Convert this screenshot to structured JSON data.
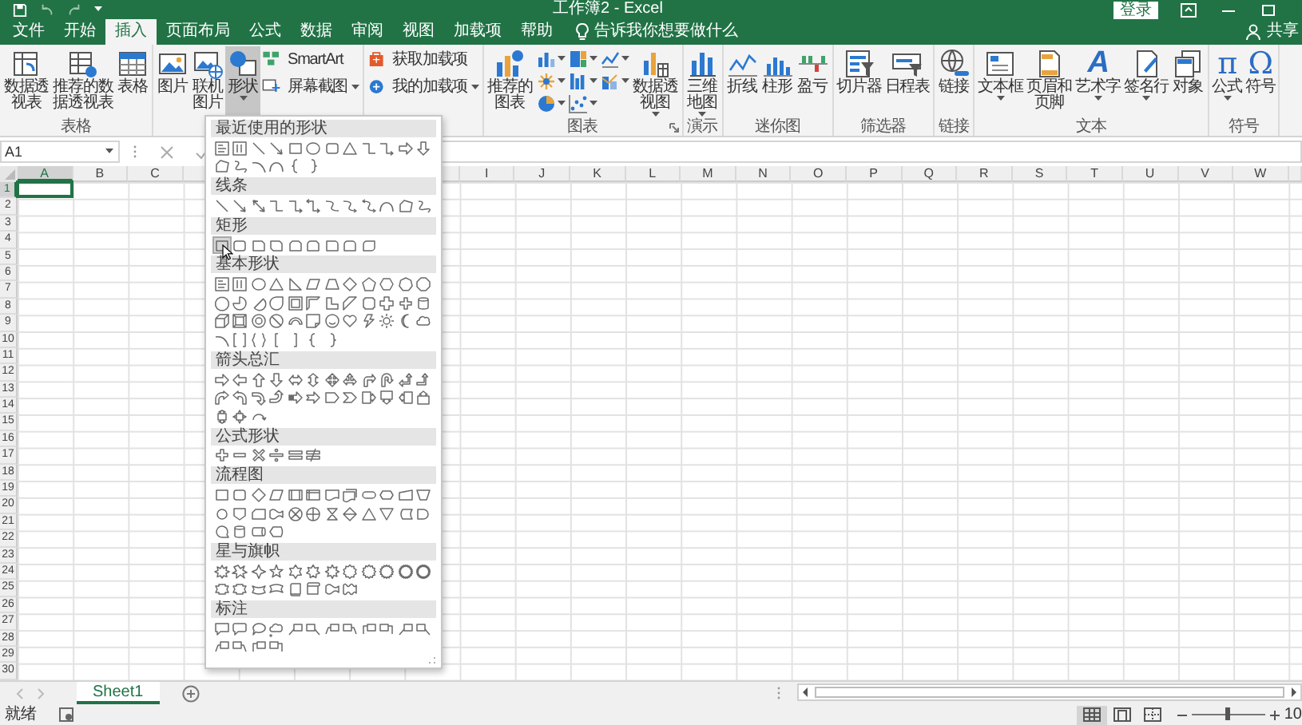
{
  "window": {
    "title": "工作簿2 - Excel",
    "login": "登录"
  },
  "tabs": [
    {
      "label": "文件",
      "selected": false
    },
    {
      "label": "开始",
      "selected": false
    },
    {
      "label": "插入",
      "selected": true
    },
    {
      "label": "页面布局",
      "selected": false
    },
    {
      "label": "公式",
      "selected": false
    },
    {
      "label": "数据",
      "selected": false
    },
    {
      "label": "审阅",
      "selected": false
    },
    {
      "label": "视图",
      "selected": false
    },
    {
      "label": "加载项",
      "selected": false
    },
    {
      "label": "帮助",
      "selected": false
    }
  ],
  "tell_me": "告诉我你想要做什么",
  "share": "共享",
  "ribbon_groups": [
    {
      "label": "表格",
      "items": [
        {
          "kind": "pivot",
          "label": "数据透视表"
        },
        {
          "kind": "recpivot",
          "label": "推荐的数据透视表"
        },
        {
          "kind": "table",
          "label": "表格"
        }
      ]
    },
    {
      "items": [
        {
          "kind": "picture",
          "label": "图片"
        },
        {
          "kind": "online",
          "label": "联机图片"
        },
        {
          "kind": "shapes",
          "label": "形状",
          "has_menu": true,
          "expanded": true
        },
        {
          "stack": [
            {
              "kind": "smartart",
              "label": "SmartArt"
            },
            {
              "kind": "screenshot",
              "label": "屏幕截图",
              "has_menu": true
            }
          ]
        }
      ]
    },
    {
      "items": [
        {
          "stack": [
            {
              "kind": "store",
              "label": "获取加载项"
            },
            {
              "kind": "myaddin",
              "label": "我的加载项",
              "has_menu": true
            }
          ]
        }
      ]
    },
    {
      "label": "图表",
      "launcher": true,
      "items": [
        {
          "kind": "recchart",
          "label": "推荐的图表"
        },
        {
          "chart_types": [
            {
              "kind": "col",
              "has_menu": true
            },
            {
              "kind": "hier",
              "has_menu": true
            },
            {
              "kind": "wfall",
              "has_menu": true
            },
            {
              "kind": "stat",
              "has_menu": true
            },
            {
              "kind": "bar",
              "has_menu": true
            },
            {
              "kind": "combo",
              "has_menu": true
            },
            {
              "kind": "pie",
              "has_menu": true
            },
            {
              "kind": "scatter",
              "has_menu": true
            }
          ]
        },
        {
          "kind": "pivotchart",
          "label": "数据透视图",
          "has_menu": true
        }
      ]
    },
    {
      "label": "演示",
      "items": [
        {
          "kind": "map",
          "label": "三维地图",
          "has_menu": true
        }
      ]
    },
    {
      "label": "迷你图",
      "items": [
        {
          "kind": "sline",
          "label": "折线"
        },
        {
          "kind": "scol",
          "label": "柱形"
        },
        {
          "kind": "swin",
          "label": "盈亏"
        }
      ]
    },
    {
      "label": "筛选器",
      "items": [
        {
          "kind": "slicer",
          "label": "切片器"
        },
        {
          "kind": "timeline",
          "label": "日程表"
        }
      ]
    },
    {
      "label": "链接",
      "items": [
        {
          "kind": "link",
          "label": "链接"
        }
      ]
    },
    {
      "label": "文本",
      "items": [
        {
          "kind": "textbox",
          "label": "文本框",
          "has_menu": true
        },
        {
          "kind": "header",
          "label": "页眉和页脚"
        },
        {
          "kind": "wordart",
          "glyph": "A",
          "label": "艺术字",
          "has_menu": true
        },
        {
          "kind": "sig",
          "label": "签名行",
          "has_menu": true
        },
        {
          "kind": "object",
          "label": "对象"
        }
      ]
    },
    {
      "label": "符号",
      "items": [
        {
          "kind": "equation",
          "glyph": "π",
          "label": "公式",
          "has_menu": true
        },
        {
          "kind": "symbol",
          "glyph": "Ω",
          "label": "符号"
        }
      ]
    }
  ],
  "name_box": "A1",
  "columns_left": [
    {
      "label": "A",
      "selected": true
    },
    {
      "label": "B",
      "selected": false
    },
    {
      "label": "C",
      "selected": false
    }
  ],
  "columns_right": [
    {
      "label": "I",
      "selected": false
    },
    {
      "label": "J",
      "selected": false
    },
    {
      "label": "K",
      "selected": false
    },
    {
      "label": "L",
      "selected": false
    },
    {
      "label": "M",
      "selected": false
    },
    {
      "label": "N",
      "selected": false
    },
    {
      "label": "O",
      "selected": false
    },
    {
      "label": "P",
      "selected": false
    },
    {
      "label": "Q",
      "selected": false
    },
    {
      "label": "R",
      "selected": false
    },
    {
      "label": "S",
      "selected": false
    },
    {
      "label": "T",
      "selected": false
    },
    {
      "label": "U",
      "selected": false
    },
    {
      "label": "V",
      "selected": false
    },
    {
      "label": "W",
      "selected": false
    }
  ],
  "rows": [
    {
      "label": "1",
      "selected": true
    },
    {
      "label": "2",
      "selected": false
    },
    {
      "label": "3",
      "selected": false
    },
    {
      "label": "4",
      "selected": false
    },
    {
      "label": "5",
      "selected": false
    },
    {
      "label": "6",
      "selected": false
    },
    {
      "label": "7",
      "selected": false
    },
    {
      "label": "8",
      "selected": false
    },
    {
      "label": "9",
      "selected": false
    },
    {
      "label": "10",
      "selected": false
    },
    {
      "label": "11",
      "selected": false
    },
    {
      "label": "12",
      "selected": false
    },
    {
      "label": "13",
      "selected": false
    },
    {
      "label": "14",
      "selected": false
    },
    {
      "label": "15",
      "selected": false
    },
    {
      "label": "16",
      "selected": false
    },
    {
      "label": "17",
      "selected": false
    },
    {
      "label": "18",
      "selected": false
    },
    {
      "label": "19",
      "selected": false
    },
    {
      "label": "20",
      "selected": false
    },
    {
      "label": "21",
      "selected": false
    },
    {
      "label": "22",
      "selected": false
    },
    {
      "label": "23",
      "selected": false
    },
    {
      "label": "24",
      "selected": false
    },
    {
      "label": "25",
      "selected": false
    },
    {
      "label": "26",
      "selected": false
    },
    {
      "label": "27",
      "selected": false
    },
    {
      "label": "28",
      "selected": false
    },
    {
      "label": "29",
      "selected": false
    },
    {
      "label": "30",
      "selected": false
    }
  ],
  "shape_menu": {
    "sections": [
      {
        "title": "最近使用的形状",
        "shapes": [
          {
            "kind": "tb"
          },
          {
            "kind": "tbv"
          },
          {
            "kind": "line"
          },
          {
            "kind": "arrow"
          },
          {
            "kind": "rect"
          },
          {
            "kind": "ellipse"
          },
          {
            "kind": "rrect"
          },
          {
            "kind": "tri"
          },
          {
            "kind": "elbow"
          },
          {
            "kind": "elbowa"
          },
          {
            "kind": "rarrow"
          },
          {
            "kind": "darrow"
          },
          {
            "kind": "freeform"
          },
          {
            "kind": "scribble"
          },
          {
            "kind": "arc"
          },
          {
            "kind": "curve"
          },
          {
            "kind": "lbrace"
          },
          {
            "kind": "rbrace"
          }
        ]
      },
      {
        "title": "线条",
        "shapes": [
          {
            "kind": "line"
          },
          {
            "kind": "arrow"
          },
          {
            "kind": "dblarrow"
          },
          {
            "kind": "elbow"
          },
          {
            "kind": "elbowa"
          },
          {
            "kind": "elbowd"
          },
          {
            "kind": "curvec"
          },
          {
            "kind": "curveca"
          },
          {
            "kind": "curvecd"
          },
          {
            "kind": "curve"
          },
          {
            "kind": "freeform"
          },
          {
            "kind": "scribble"
          }
        ]
      },
      {
        "title": "矩形",
        "shapes": [
          {
            "kind": "rect",
            "hovered": true
          },
          {
            "kind": "rrect"
          },
          {
            "kind": "snip"
          },
          {
            "kind": "snip2"
          },
          {
            "kind": "snip3"
          },
          {
            "kind": "sniprnd"
          },
          {
            "kind": "round1"
          },
          {
            "kind": "round2"
          },
          {
            "kind": "roundd"
          }
        ]
      },
      {
        "title": "基本形状",
        "shapes": [
          {
            "kind": "tb"
          },
          {
            "kind": "tbv"
          },
          {
            "kind": "ellipse"
          },
          {
            "kind": "tri"
          },
          {
            "kind": "rtri"
          },
          {
            "kind": "para"
          },
          {
            "kind": "trap"
          },
          {
            "kind": "diamond"
          },
          {
            "kind": "pent"
          },
          {
            "kind": "hex"
          },
          {
            "kind": "hept"
          },
          {
            "kind": "oct"
          },
          {
            "kind": "dodec"
          },
          {
            "kind": "pie"
          },
          {
            "kind": "chord"
          },
          {
            "kind": "teardrop"
          },
          {
            "kind": "frame"
          },
          {
            "kind": "halfframe"
          },
          {
            "kind": "lshape"
          },
          {
            "kind": "diag"
          },
          {
            "kind": "plaque"
          },
          {
            "kind": "cross"
          },
          {
            "kind": "plus"
          },
          {
            "kind": "can"
          },
          {
            "kind": "cube"
          },
          {
            "kind": "bevel"
          },
          {
            "kind": "donut"
          },
          {
            "kind": "nosym"
          },
          {
            "kind": "blockarc"
          },
          {
            "kind": "foldc"
          },
          {
            "kind": "smile"
          },
          {
            "kind": "heart"
          },
          {
            "kind": "lightning"
          },
          {
            "kind": "sun"
          },
          {
            "kind": "moon"
          },
          {
            "kind": "cloud"
          },
          {
            "kind": "arc"
          },
          {
            "kind": "dblbracket"
          },
          {
            "kind": "dblbrace"
          },
          {
            "kind": "lbracket"
          },
          {
            "kind": "rbracket"
          },
          {
            "kind": "lbrace"
          },
          {
            "kind": "rbrace"
          }
        ]
      },
      {
        "title": "箭头总汇",
        "shapes": [
          {
            "kind": "rarrow"
          },
          {
            "kind": "larrow"
          },
          {
            "kind": "uarrow"
          },
          {
            "kind": "darrow"
          },
          {
            "kind": "lrarrow"
          },
          {
            "kind": "udarrow"
          },
          {
            "kind": "quad"
          },
          {
            "kind": "lrup"
          },
          {
            "kind": "bentarrow"
          },
          {
            "kind": "uturn"
          },
          {
            "kind": "lupbent"
          },
          {
            "kind": "bentup"
          },
          {
            "kind": "curvr"
          },
          {
            "kind": "curvl"
          },
          {
            "kind": "curvu"
          },
          {
            "kind": "curvd"
          },
          {
            "kind": "stripedr"
          },
          {
            "kind": "notchedr"
          },
          {
            "kind": "pentarrow"
          },
          {
            "kind": "chevron"
          },
          {
            "kind": "rac"
          },
          {
            "kind": "dac"
          },
          {
            "kind": "lac"
          },
          {
            "kind": "uac"
          },
          {
            "kind": "udac"
          },
          {
            "kind": "quadac"
          },
          {
            "kind": "circarrow"
          }
        ]
      },
      {
        "title": "公式形状",
        "shapes": [
          {
            "kind": "plus"
          },
          {
            "kind": "minus"
          },
          {
            "kind": "mult"
          },
          {
            "kind": "div"
          },
          {
            "kind": "equal"
          },
          {
            "kind": "noteq"
          }
        ]
      },
      {
        "title": "流程图",
        "shapes": [
          {
            "kind": "rect"
          },
          {
            "kind": "rrect"
          },
          {
            "kind": "diamond"
          },
          {
            "kind": "para"
          },
          {
            "kind": "fpre"
          },
          {
            "kind": "fint"
          },
          {
            "kind": "fdoc"
          },
          {
            "kind": "fmdoc"
          },
          {
            "kind": "fterm"
          },
          {
            "kind": "fprep"
          },
          {
            "kind": "fman"
          },
          {
            "kind": "fmanop"
          },
          {
            "kind": "fconn"
          },
          {
            "kind": "foff"
          },
          {
            "kind": "fcard"
          },
          {
            "kind": "ftape"
          },
          {
            "kind": "fsum"
          },
          {
            "kind": "for"
          },
          {
            "kind": "fcoll"
          },
          {
            "kind": "fsort"
          },
          {
            "kind": "tri"
          },
          {
            "kind": "itri"
          },
          {
            "kind": "fstored"
          },
          {
            "kind": "fdelay"
          },
          {
            "kind": "fseq"
          },
          {
            "kind": "can"
          },
          {
            "kind": "fdirect"
          },
          {
            "kind": "fdisp"
          }
        ]
      },
      {
        "title": "星与旗帜",
        "shapes": [
          {
            "kind": "burst"
          },
          {
            "kind": "burst2"
          },
          {
            "kind": "star4"
          },
          {
            "kind": "star5"
          },
          {
            "kind": "star6"
          },
          {
            "kind": "star7"
          },
          {
            "kind": "star8"
          },
          {
            "kind": "star10"
          },
          {
            "kind": "star12"
          },
          {
            "kind": "star16"
          },
          {
            "kind": "star24"
          },
          {
            "kind": "star32"
          },
          {
            "kind": "ribbon"
          },
          {
            "kind": "ribbon2"
          },
          {
            "kind": "curvrib"
          },
          {
            "kind": "curvrib2"
          },
          {
            "kind": "vscroll"
          },
          {
            "kind": "hscroll"
          },
          {
            "kind": "wave"
          },
          {
            "kind": "dwave"
          }
        ]
      },
      {
        "title": "标注",
        "shapes": [
          {
            "kind": "callout"
          },
          {
            "kind": "rcallout"
          },
          {
            "kind": "ocallout"
          },
          {
            "kind": "cloudc"
          },
          {
            "kind": "linec1"
          },
          {
            "kind": "linec2"
          },
          {
            "kind": "linec3"
          },
          {
            "kind": "linec4"
          },
          {
            "kind": "linec5"
          },
          {
            "kind": "linec6"
          },
          {
            "kind": "linec7"
          },
          {
            "kind": "linec8"
          },
          {
            "kind": "linec9"
          },
          {
            "kind": "linec10"
          },
          {
            "kind": "linec11"
          },
          {
            "kind": "linec12"
          }
        ]
      }
    ]
  },
  "sheets": [
    {
      "label": "Sheet1",
      "selected": true
    }
  ],
  "status": {
    "text": "就绪",
    "views": [
      {
        "kind": "normal",
        "selected": true
      },
      {
        "kind": "layout",
        "selected": false
      },
      {
        "kind": "pagebreak",
        "selected": false
      }
    ],
    "zoom": {
      "level": 0.5,
      "reading": "10"
    }
  }
}
